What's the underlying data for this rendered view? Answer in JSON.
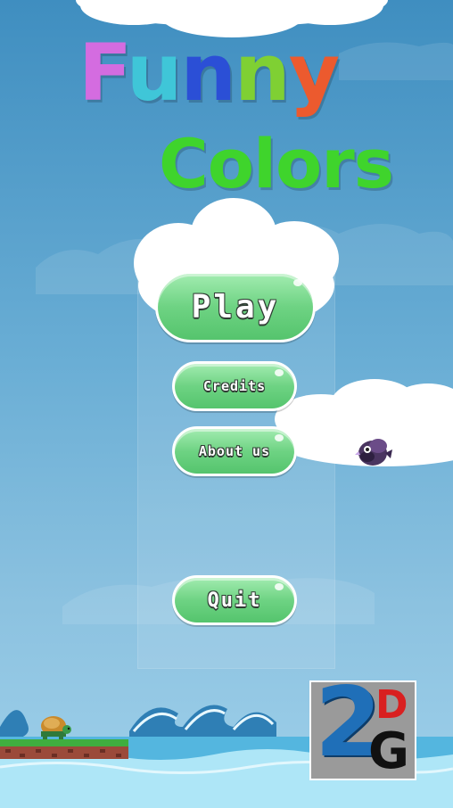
{
  "title": {
    "line1_letters": [
      {
        "char": "F",
        "color": "#d46ce0"
      },
      {
        "char": "u",
        "color": "#3fc6d8"
      },
      {
        "char": "n",
        "color": "#2b4fd6"
      },
      {
        "char": "n",
        "color": "#7fd033"
      },
      {
        "char": "y",
        "color": "#ec5a2e"
      }
    ],
    "line2": "Colors",
    "line2_color": "#3fd42c"
  },
  "menu": {
    "play_label": "Play",
    "credits_label": "Credits",
    "about_label": "About us",
    "quit_label": "Quit"
  },
  "logo": {
    "big": "2",
    "top": "D",
    "bottom": "G"
  },
  "colors": {
    "button_green": "#6ed383",
    "button_outline": "#2f3b33",
    "sky": "#3f8ec0",
    "water": "#aee6f7"
  },
  "sprites": [
    "flying-bird-enemy",
    "turtle-player"
  ]
}
